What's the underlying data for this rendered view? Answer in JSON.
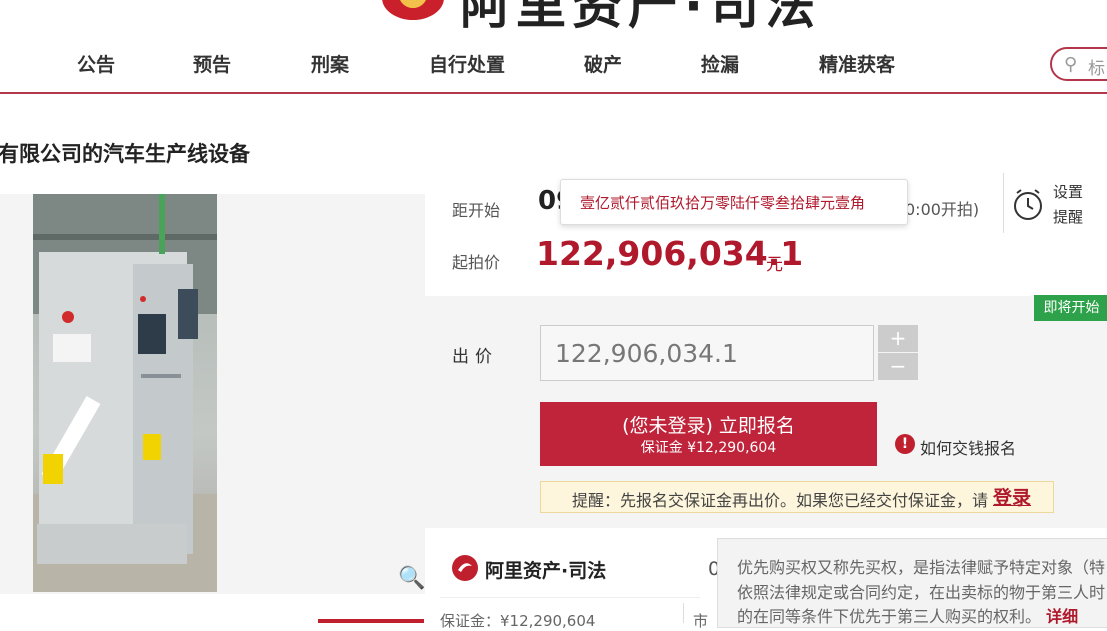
{
  "header": {
    "logo_text": "阿里资产·司法",
    "nav": [
      "公告",
      "预告",
      "刑案",
      "自行处置",
      "破产",
      "捡漏",
      "精准获客"
    ],
    "search_placeholder": "标"
  },
  "page_title": "有限公司的汽车生产线设备",
  "auction": {
    "countdown_label": "距开始",
    "countdown_value": "09",
    "start_time_tail": "0:00开拍)",
    "remind_line1": "设置",
    "remind_line2": "提醒",
    "tooltip_text": "壹亿贰仟贰佰玖拾万零陆仟零叁拾肆元壹角",
    "start_price_label": "起拍价",
    "start_price": "122,906,034.1",
    "price_unit": "元",
    "status_badge": "即将开始",
    "bid_label": "出价",
    "bid_value": "122,906,034.1",
    "plus": "+",
    "minus": "−",
    "signup_line1": "(您未登录) 立即报名",
    "signup_line2": "保证金 ¥12,290,604",
    "howto": "如何交钱报名",
    "notice_text": "提醒：先报名交保证金再出价。如果您已经交付保证金，请",
    "notice_link": "登录"
  },
  "bottom": {
    "brand": "阿里资产·司法",
    "deposit": "保证金：¥12,290,604",
    "partial_zero": "0",
    "market": "市",
    "popover_lines": [
      "优先购买权又称先买权，是指法律赋予特定对象（特",
      "依照法律规定或合同约定，在出卖标的物于第三人时",
      "的在同等条件下优先于第三人购买的权利。"
    ],
    "popover_link": "详细"
  },
  "colors": {
    "brand_red": "#b0182b",
    "badge_green": "#2ea24a"
  }
}
